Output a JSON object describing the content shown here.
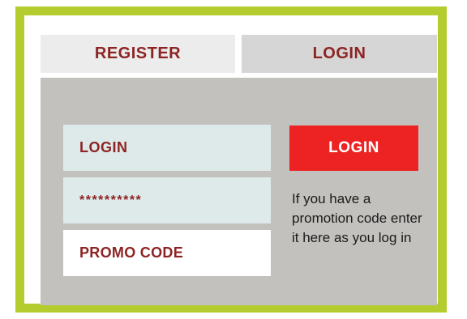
{
  "tabs": {
    "register_label": "REGISTER",
    "login_label": "LOGIN"
  },
  "form": {
    "login_field_value": "LOGIN",
    "password_field_value": "**********",
    "promo_field_value": "PROMO CODE",
    "login_button_label": "LOGIN",
    "promo_help_text": "If you have a promotion code enter it here as you log in"
  },
  "colors": {
    "border": "#b5cc2e",
    "panel": "#c3c1bd",
    "label_text": "#8e2323",
    "button": "#ed2323",
    "input_fill": "#deeaea"
  }
}
